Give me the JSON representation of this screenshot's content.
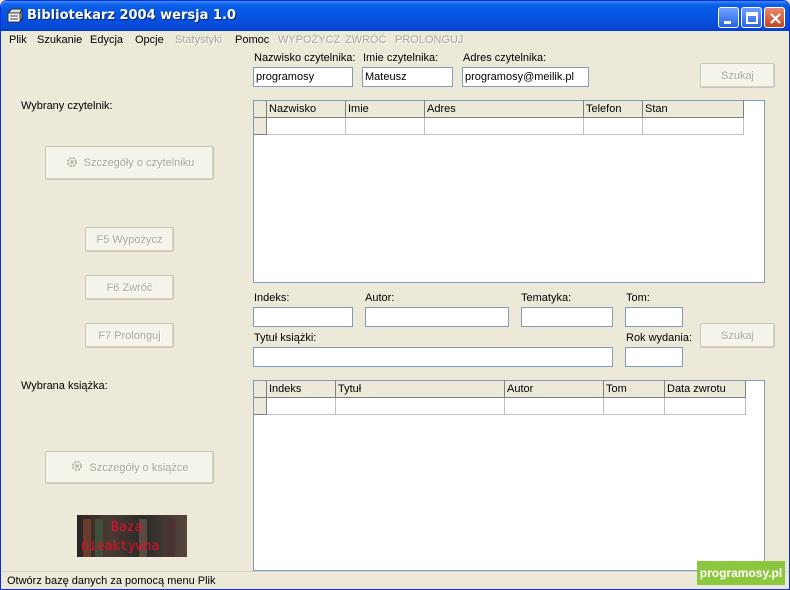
{
  "window": {
    "title": "Bibliotekarz 2004 wersja 1.0"
  },
  "menu": [
    {
      "label": "Plik",
      "enabled": true
    },
    {
      "label": "Szukanie",
      "enabled": true
    },
    {
      "label": "Edycja",
      "enabled": true
    },
    {
      "label": "Opcje",
      "enabled": true
    },
    {
      "label": "Statystyki",
      "enabled": false
    },
    {
      "label": "Pomoc",
      "enabled": true
    },
    {
      "label": "WYPOŻYCZ",
      "enabled": false
    },
    {
      "label": "ZWRÓĆ",
      "enabled": false
    },
    {
      "label": "PROLONGUJ",
      "enabled": false
    }
  ],
  "reader_search": {
    "surname_label": "Nazwisko czytelnika:",
    "surname_value": "programosy",
    "name_label": "Imie czytelnika:",
    "name_value": "Mateusz",
    "address_label": "Adres czytelnika:",
    "address_value": "programosy@meilik.pl",
    "search_button": "Szukaj"
  },
  "left_panel": {
    "selected_reader_label": "Wybrany czytelnik:",
    "reader_details_button": "Szczegóły o czytelniku",
    "lend_button": "F5 Wypożycz",
    "return_button": "F6 Zwróć",
    "prolong_button": "F7 Prolonguj",
    "selected_book_label": "Wybrana książka:",
    "book_details_button": "Szczegóły o książce",
    "badge_line1": "Baza",
    "badge_line2": "nieaktywna"
  },
  "reader_grid": {
    "columns": [
      "Nazwisko",
      "Imie",
      "Adres",
      "Telefon",
      "Stan"
    ]
  },
  "book_search": {
    "index_label": "Indeks:",
    "author_label": "Autor:",
    "subject_label": "Tematyka:",
    "volume_label": "Tom:",
    "title_label": "Tytuł książki:",
    "year_label": "Rok wydania:",
    "search_button": "Szukaj"
  },
  "book_grid": {
    "columns": [
      "Indeks",
      "Tytuł",
      "Autor",
      "Tom",
      "Data zwrotu"
    ]
  },
  "status": {
    "text": "Otwórz bazę danych za pomocą menu Plik"
  },
  "watermark": {
    "text": "programosy.pl"
  },
  "colors": {
    "titlebar": "#0553E2",
    "face": "#ECE9D8",
    "disabled_text": "#A7A697",
    "badge_text": "#E0102A",
    "watermark_bg": "#8DC63F"
  }
}
